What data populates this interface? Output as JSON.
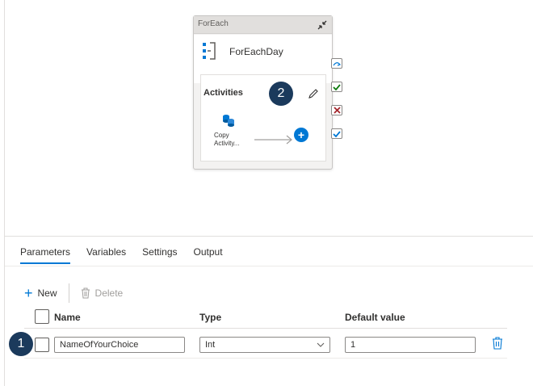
{
  "pipeline": {
    "foreach": {
      "type_label": "ForEach",
      "name": "ForEachDay",
      "activities_label": "Activities",
      "inner_activity_label": "Copy Activity..."
    },
    "badges": {
      "one": "1",
      "two": "2"
    }
  },
  "panel": {
    "tabs": [
      {
        "label": "Parameters",
        "active": true
      },
      {
        "label": "Variables",
        "active": false
      },
      {
        "label": "Settings",
        "active": false
      },
      {
        "label": "Output",
        "active": false
      }
    ],
    "toolbar": {
      "new_label": "New",
      "delete_label": "Delete"
    },
    "grid": {
      "headers": {
        "name": "Name",
        "type": "Type",
        "default": "Default value"
      },
      "rows": [
        {
          "name": "NameOfYourChoice",
          "type": "Int",
          "default": "1"
        }
      ]
    }
  },
  "icons": {
    "collapse": "collapse-icon",
    "foreach": "foreach-icon",
    "edit": "pencil-icon",
    "copy": "copy-activity-icon",
    "add": "add-activity-icon",
    "skip": "skip-icon",
    "success": "success-icon",
    "failure": "failure-icon",
    "completion": "completion-icon",
    "delete": "trash-icon",
    "chevron": "chevron-down-icon"
  },
  "colors": {
    "accent": "#0078d4",
    "badge": "#1b3a5c",
    "success": "#107c10",
    "failure": "#a4262c"
  }
}
